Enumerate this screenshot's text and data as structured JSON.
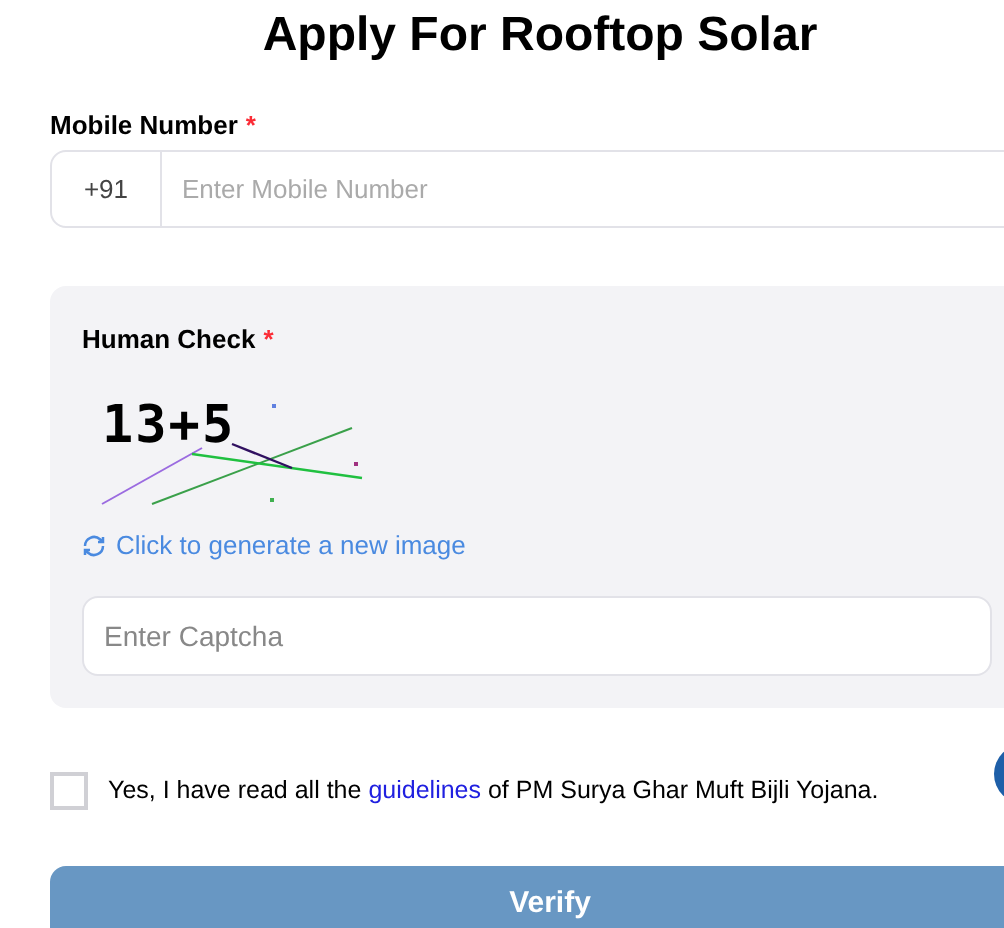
{
  "title": "Apply For Rooftop Solar",
  "mobile": {
    "label": "Mobile Number",
    "required_mark": "*",
    "prefix": "+91",
    "placeholder": "Enter Mobile Number"
  },
  "human_check": {
    "label": "Human Check",
    "required_mark": "*",
    "captcha": "13+5",
    "refresh_link": "Click to generate a new image",
    "placeholder": "Enter Captcha"
  },
  "agreement": {
    "checked": false,
    "text_before": "Yes, I have read all the",
    "link": "guidelines",
    "text_after": "of PM Surya Ghar Muft Bijli Yojana."
  },
  "verify_button": {
    "label": "Verify",
    "disabled": true
  }
}
